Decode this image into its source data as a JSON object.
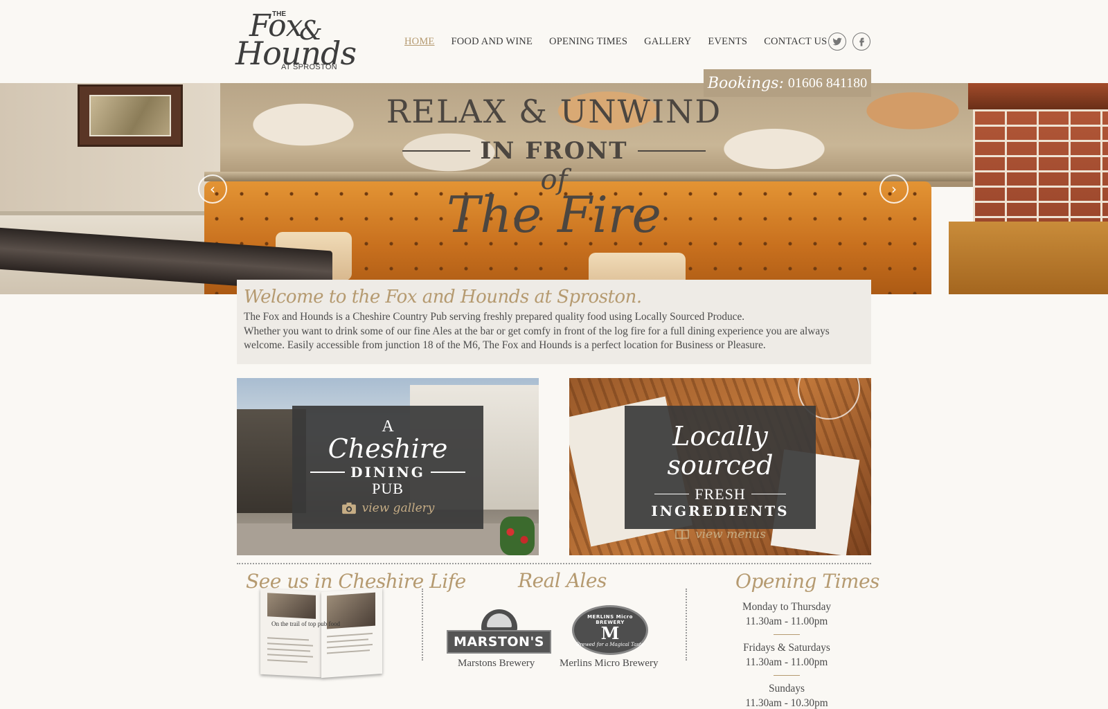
{
  "header": {
    "logo": {
      "the": "THE",
      "word1": "Fox",
      "amp": "&",
      "word2": "Hounds",
      "location": "AT SPROSTON"
    },
    "nav": [
      {
        "label": "HOME",
        "active": true
      },
      {
        "label": "FOOD AND WINE"
      },
      {
        "label": "OPENING TIMES"
      },
      {
        "label": "GALLERY"
      },
      {
        "label": "EVENTS"
      },
      {
        "label": "CONTACT US"
      }
    ],
    "social": [
      {
        "icon": "twitter-icon"
      },
      {
        "icon": "facebook-icon"
      }
    ],
    "bookings": {
      "label": "Bookings:",
      "phone": "01606 841180"
    }
  },
  "hero": {
    "line1": "RELAX & UNWIND",
    "line2": "IN FRONT",
    "line3": "of",
    "line4": "The Fire",
    "prev_icon": "chevron-left-icon",
    "next_icon": "chevron-right-icon"
  },
  "welcome": {
    "title": "Welcome to the Fox and Hounds at Sproston.",
    "p1": "The Fox and Hounds is a Cheshire Country Pub serving freshly prepared quality food using Locally Sourced Produce.",
    "p2": "Whether you want to drink some of our fine Ales at the bar or get comfy in front of the log fire for a full dining experience you are always welcome. Easily accessible from junction 18 of the M6, The Fox and Hounds is a perfect location for Business or Pleasure."
  },
  "promos": {
    "left": {
      "a": "A",
      "script": "Cheshire",
      "caps": "DINING",
      "caps2": "PUB",
      "link": "view gallery",
      "icon": "camera-icon"
    },
    "right": {
      "script": "Locally sourced",
      "caps2": "FRESH",
      "caps": "INGREDIENTS",
      "link": "view menus",
      "icon": "book-icon"
    }
  },
  "bottom": {
    "cheshire_life": {
      "title": "See us in Cheshire Life",
      "mag_headline": "On the trail of top pub food"
    },
    "real_ales": {
      "title": "Real Ales",
      "breweries": [
        {
          "logo_text": "MARSTON'S",
          "caption": "Marstons Brewery"
        },
        {
          "logo_top": "MERLINS Micro BREWERY",
          "logo_mark": "M",
          "logo_bottom": "Brewed for a Magical Taste",
          "caption": "Merlins Micro Brewery"
        }
      ]
    },
    "opening": {
      "title": "Opening Times",
      "rows": [
        {
          "days": "Monday to Thursday",
          "hours": "11.30am - 11.00pm"
        },
        {
          "days": "Fridays & Saturdays",
          "hours": "11.30am - 11.00pm"
        },
        {
          "days": "Sundays",
          "hours": "11.30am - 10.30pm"
        }
      ]
    }
  },
  "colors": {
    "accent": "#b59a70",
    "bookings_bg": "#b3a083",
    "box_bg": "#3a3a3a",
    "page_bg": "#faf8f4"
  }
}
